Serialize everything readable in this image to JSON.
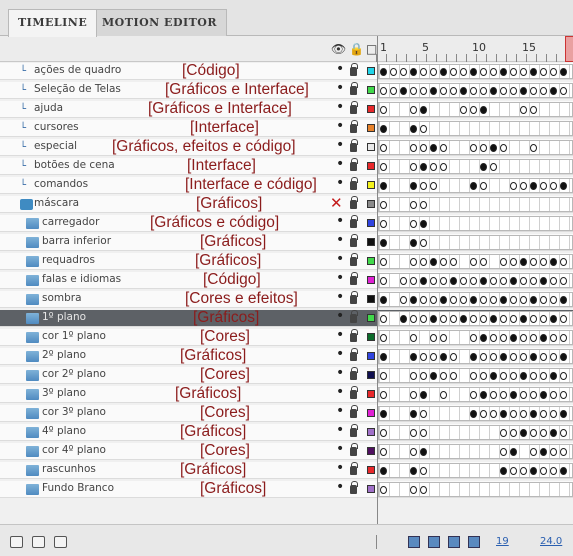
{
  "tabs": {
    "timeline": "TIMELINE",
    "motion_editor": "MOTION EDITOR"
  },
  "frame_numbers": [
    "1",
    "5",
    "10",
    "15"
  ],
  "status": {
    "current_frame": "19",
    "fps": "24.0"
  },
  "layers": [
    {
      "name": "ações de quadro",
      "annotation": "[Código]",
      "kind": "folder",
      "color": "#22d4e8",
      "kf": [
        0,
        1,
        2,
        3,
        4,
        5,
        6,
        7,
        8,
        9,
        10,
        11,
        12,
        13,
        14,
        15,
        16,
        17,
        18
      ]
    },
    {
      "name": "Seleção de Telas",
      "annotation": "[Gráficos e Interface]",
      "kind": "folder",
      "color": "#41d94b",
      "kf": [
        0,
        1,
        2,
        3,
        4,
        5,
        6,
        7,
        8,
        9,
        10,
        11,
        12,
        13,
        14,
        15,
        16,
        17,
        18
      ]
    },
    {
      "name": "ajuda",
      "annotation": "[Gráficos e Interface]",
      "kind": "folder",
      "color": "#e8282b",
      "kf": [
        0,
        3,
        4,
        8,
        9,
        10,
        14,
        15
      ]
    },
    {
      "name": "cursores",
      "annotation": "[Interface]",
      "kind": "folder",
      "color": "#e8822b",
      "kf": [
        0,
        3,
        4
      ]
    },
    {
      "name": "especial",
      "annotation": "[Gráficos, efeitos e código]",
      "kind": "folder",
      "color": "#e8e8e8",
      "kf": [
        0,
        3,
        4,
        5,
        6,
        9,
        10,
        11,
        12,
        15
      ]
    },
    {
      "name": "botões de cena",
      "annotation": "[Interface]",
      "kind": "folder",
      "color": "#e8282b",
      "kf": [
        0,
        3,
        4,
        5,
        6,
        10,
        11
      ]
    },
    {
      "name": "comandos",
      "annotation": "[Interface e código]",
      "kind": "folder",
      "color": "#f4f21c",
      "kf": [
        0,
        3,
        4,
        5,
        9,
        10,
        13,
        14,
        15,
        16,
        17,
        18
      ]
    },
    {
      "name": "máscara",
      "annotation": "[Gráficos]",
      "kind": "mask",
      "color": "#8a8a8a",
      "kf": [
        0,
        3,
        4
      ]
    },
    {
      "name": "carregador",
      "annotation": "[Gráficos e código]",
      "kind": "layer",
      "color": "#3044e0",
      "kf": [
        0,
        3,
        4
      ]
    },
    {
      "name": "barra inferior",
      "annotation": "[Gráficos]",
      "kind": "layer",
      "color": "#101010",
      "kf": [
        0,
        3,
        4
      ]
    },
    {
      "name": "requadros",
      "annotation": "[Gráficos]",
      "kind": "layer",
      "color": "#41d94b",
      "kf": [
        0,
        3,
        4,
        5,
        6,
        7,
        9,
        10,
        12,
        13,
        14,
        15,
        16,
        17,
        18
      ]
    },
    {
      "name": "falas e idiomas",
      "annotation": "[Código]",
      "kind": "layer",
      "color": "#e021d4",
      "kf": [
        0,
        2,
        3,
        4,
        5,
        6,
        7,
        8,
        9,
        10,
        11,
        12,
        13,
        14,
        15,
        16,
        17,
        18
      ]
    },
    {
      "name": "sombra",
      "annotation": "[Cores e efeitos]",
      "kind": "layer",
      "color": "#101010",
      "kf": [
        0,
        2,
        3,
        4,
        5,
        6,
        7,
        8,
        9,
        10,
        11,
        12,
        13,
        14,
        15,
        16,
        17,
        18
      ]
    },
    {
      "name": "1º plano",
      "annotation": "[Gráficos]",
      "kind": "layer",
      "color": "#41d94b",
      "kf": [
        0,
        2,
        3,
        4,
        5,
        6,
        7,
        8,
        9,
        10,
        11,
        12,
        13,
        14,
        15,
        16,
        17,
        18
      ]
    },
    {
      "name": "cor 1º plano",
      "annotation": "[Cores]",
      "kind": "layer",
      "color": "#0b6b2a",
      "kf": [
        0,
        3,
        5,
        6,
        9,
        10,
        11,
        12,
        13,
        14,
        15,
        16,
        17,
        18
      ]
    },
    {
      "name": "2º plano",
      "annotation": "[Gráficos]",
      "kind": "layer",
      "color": "#3044e0",
      "kf": [
        0,
        3,
        4,
        5,
        6,
        7,
        9,
        10,
        11,
        12,
        13,
        14,
        15,
        16,
        17,
        18
      ]
    },
    {
      "name": "cor 2º plano",
      "annotation": "[Cores]",
      "kind": "layer",
      "color": "#101050",
      "kf": [
        0,
        3,
        4,
        5,
        6,
        7,
        9,
        10,
        11,
        12,
        13,
        14,
        15,
        16,
        17,
        18
      ]
    },
    {
      "name": "3º plano",
      "annotation": "[Gráficos]",
      "kind": "layer",
      "color": "#e8282b",
      "kf": [
        0,
        3,
        4,
        6,
        9,
        10,
        11,
        12,
        13,
        14,
        15,
        16,
        17,
        18
      ]
    },
    {
      "name": "cor 3º plano",
      "annotation": "[Cores]",
      "kind": "layer",
      "color": "#e021d4",
      "kf": [
        0,
        3,
        4,
        9,
        10,
        11,
        12,
        13,
        14,
        15,
        16,
        17,
        18
      ]
    },
    {
      "name": "4º plano",
      "annotation": "[Gráficos]",
      "kind": "layer",
      "color": "#a070c8",
      "kf": [
        0,
        3,
        4,
        12,
        13,
        14,
        15,
        16,
        17,
        18
      ]
    },
    {
      "name": "cor 4º plano",
      "annotation": "[Cores]",
      "kind": "layer",
      "color": "#501060",
      "kf": [
        0,
        3,
        4,
        12,
        13,
        15,
        16,
        17,
        18
      ]
    },
    {
      "name": "rascunhos",
      "annotation": "[Gráficos]",
      "kind": "layer",
      "color": "#e8282b",
      "kf": [
        0,
        3,
        4,
        12,
        13,
        14,
        15,
        16,
        17,
        18
      ]
    },
    {
      "name": "Fundo Branco",
      "annotation": "[Gráficos]",
      "kind": "layer",
      "color": "#a070c8",
      "kf": [
        0,
        3,
        4
      ]
    }
  ]
}
